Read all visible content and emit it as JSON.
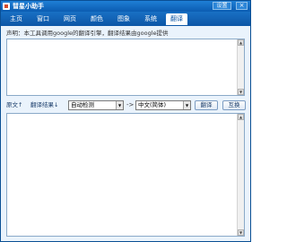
{
  "window": {
    "title": "彗星小助手",
    "settings_label": "设置",
    "close_label": "×"
  },
  "tabs": [
    {
      "label": "主页",
      "active": false
    },
    {
      "label": "窗口",
      "active": false
    },
    {
      "label": "网页",
      "active": false
    },
    {
      "label": "颜色",
      "active": false
    },
    {
      "label": "图象",
      "active": false
    },
    {
      "label": "系统",
      "active": false
    },
    {
      "label": "翻译",
      "active": true
    }
  ],
  "translate": {
    "notice": "声明：本工具调用google的翻译引擎，翻译结果由google提供",
    "source_value": "",
    "source_label": "原文↑",
    "result_label": "翻译结果↓",
    "from_language": "自动检测",
    "arrow": "->",
    "to_language": "中文(简体)",
    "translate_button": "翻译",
    "swap_button": "互换",
    "result_value": ""
  },
  "colors": {
    "title_bar": "#0b5cb1",
    "tab_bar": "#1970c4",
    "window_bg": "#eaf3fc"
  }
}
